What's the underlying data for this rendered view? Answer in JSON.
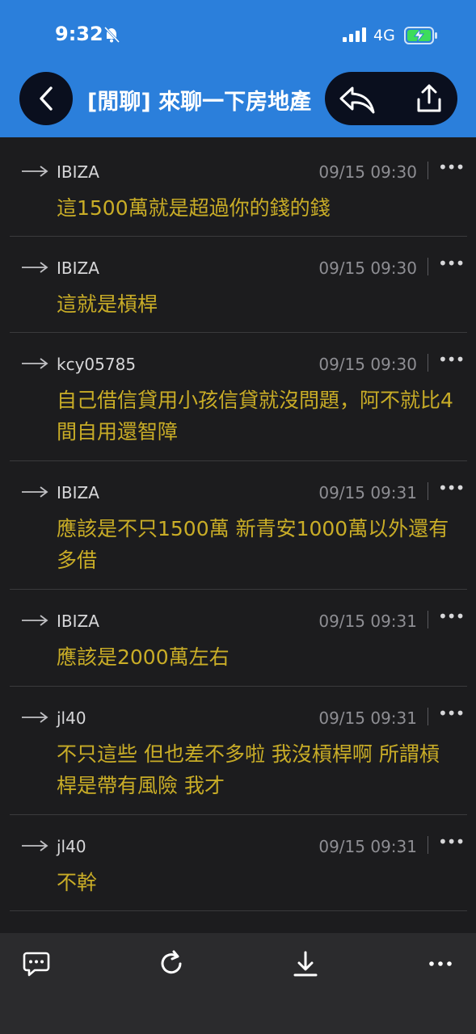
{
  "status_bar": {
    "time": "9:32",
    "network": "4G"
  },
  "nav": {
    "title": "[閒聊] 來聊一下房地產"
  },
  "comments": [
    {
      "user": "IBIZA",
      "time": "09/15 09:30",
      "text": "這1500萬就是超過你的錢的錢"
    },
    {
      "user": "IBIZA",
      "time": "09/15 09:30",
      "text": "這就是槓桿"
    },
    {
      "user": "kcy05785",
      "time": "09/15 09:30",
      "text": "自己借信貸用小孩信貸就沒問題，阿不就比4間自用還智障"
    },
    {
      "user": "IBIZA",
      "time": "09/15 09:31",
      "text": "應該是不只1500萬  新青安1000萬以外還有多借"
    },
    {
      "user": "IBIZA",
      "time": "09/15 09:31",
      "text": "應該是2000萬左右"
    },
    {
      "user": "jl40",
      "time": "09/15 09:31",
      "text": "不只這些 但也差不多啦 我沒槓桿啊 所謂槓桿是帶有風險 我才"
    },
    {
      "user": "jl40",
      "time": "09/15 09:31",
      "text": "不幹"
    }
  ],
  "toolbar": {
    "icons": [
      "comment-icon",
      "refresh-icon",
      "download-icon",
      "more-icon"
    ]
  },
  "colors": {
    "header": "#2b7fdb",
    "background": "#1c1c1e",
    "comment_text": "#c9ad27",
    "toolbar": "#2b2b2d"
  }
}
